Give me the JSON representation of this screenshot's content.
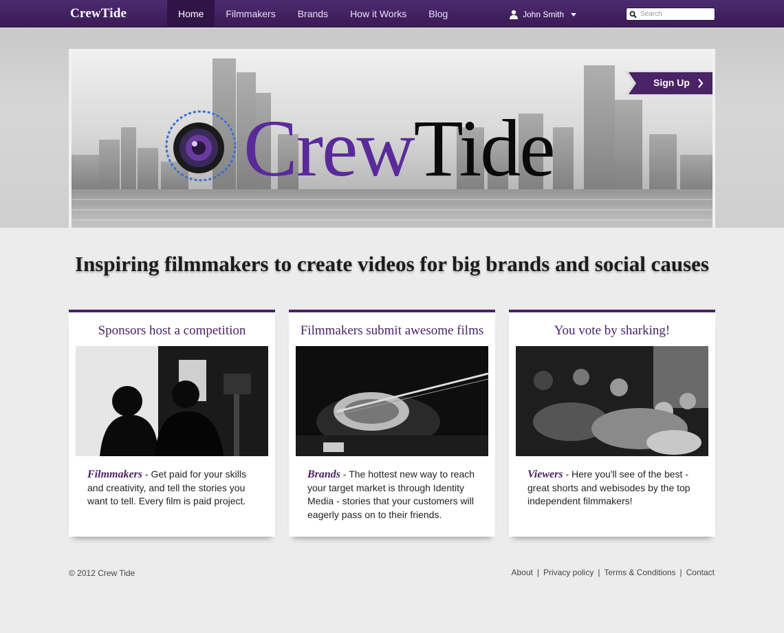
{
  "navbar": {
    "brand": "CrewTide",
    "links": [
      {
        "label": "Home",
        "active": true
      },
      {
        "label": "Filmmakers",
        "active": false
      },
      {
        "label": "Brands",
        "active": false
      },
      {
        "label": "How it Works",
        "active": false
      },
      {
        "label": "Blog",
        "active": false
      }
    ],
    "user_name": "John Smith",
    "search_placeholder": "Search"
  },
  "hero": {
    "logo_part1": "Crew",
    "logo_part2": "Tide",
    "signup_label": "Sign Up"
  },
  "tagline": "Inspiring filmmakers to create videos for big brands and social causes",
  "cards": [
    {
      "title": "Sponsors host a competition",
      "lead": "Filmmakers",
      "text": " - Get paid for your skills and creativity, and tell the stories you want to tell. Every film is paid project."
    },
    {
      "title": "Filmmakers submit awesome films",
      "lead": "Brands",
      "text": " - The hottest new way to reach your target market is through Identity Media - stories that your customers will eagerly pass on to their friends."
    },
    {
      "title": "You vote by sharking!",
      "lead": "Viewers",
      "text": " - Here you'll see of the best - great shorts and webisodes by the top independent filmmakers!"
    }
  ],
  "footer": {
    "copyright": "© 2012 Crew Tide",
    "links": [
      "About",
      "Privacy policy",
      "Terms & Conditions",
      "Contact"
    ],
    "separator": "|"
  },
  "colors": {
    "navbar": "#3f1e5c",
    "accent_purple": "#4a2266",
    "logo_purple": "#5a2a9a",
    "page_bg": "#ececec"
  },
  "icons": {
    "user": "user-icon",
    "caret": "caret-down-icon",
    "search": "search-icon",
    "signup_chevron": "chevron-right-icon"
  }
}
